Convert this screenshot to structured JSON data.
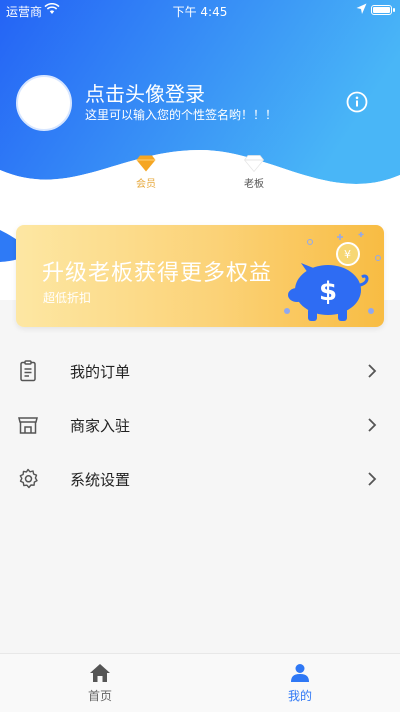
{
  "status_bar": {
    "carrier": "运营商",
    "time": "下午 4:45"
  },
  "profile": {
    "login_prompt": "点击头像登录",
    "signature_hint": "这里可以输入您的个性签名哟！！！"
  },
  "badges": [
    {
      "label": "会员",
      "icon": "diamond-icon",
      "color": "#f5a623"
    },
    {
      "label": "老板",
      "icon": "diamond-icon",
      "color": "#ffffff"
    }
  ],
  "banner": {
    "title": "升级老板获得更多权益",
    "subtitle": "超低折扣"
  },
  "menu": [
    {
      "label": "我的订单",
      "icon": "clipboard-icon"
    },
    {
      "label": "商家入驻",
      "icon": "store-icon"
    },
    {
      "label": "系统设置",
      "icon": "gear-icon"
    }
  ],
  "tabs": [
    {
      "label": "首页",
      "icon": "home-icon",
      "active": false
    },
    {
      "label": "我的",
      "icon": "user-icon",
      "active": true
    }
  ],
  "colors": {
    "header_gradient_start": "#2a6ef7",
    "header_gradient_end": "#4ab8f7",
    "active_tab": "#2f78f5",
    "banner": "#f8bc43"
  }
}
